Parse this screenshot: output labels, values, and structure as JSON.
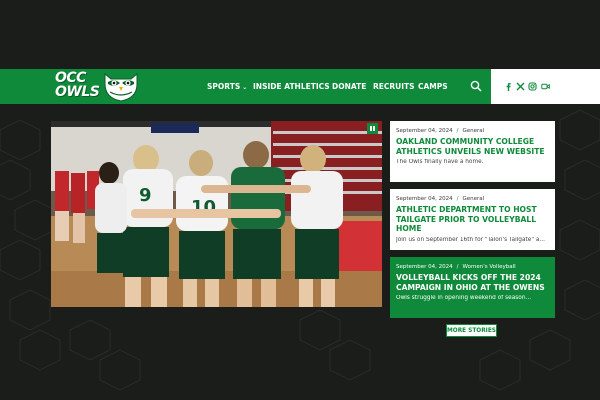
{
  "brand": {
    "line1": "OCC",
    "line2": "OWLS",
    "primary_color": "#0f8a3a",
    "background_color": "#1b1d1b",
    "mascot_icon": "owl-logo-icon"
  },
  "nav": {
    "items": [
      {
        "label": "SPORTS",
        "has_dropdown": true
      },
      {
        "label": "INSIDE ATHLETICS",
        "has_dropdown": true
      },
      {
        "label": "DONATE",
        "has_dropdown": false
      },
      {
        "label": "RECRUITS",
        "has_dropdown": false
      },
      {
        "label": "CAMPS",
        "has_dropdown": false
      }
    ],
    "dropdown_glyph": "⌄",
    "search_icon": "search-icon"
  },
  "social": {
    "icons": [
      "facebook-icon",
      "x-icon",
      "instagram-icon",
      "video-icon"
    ]
  },
  "hero": {
    "image_icon": "photo-volleyball-team-huddle",
    "pause_icon": "pause-icon"
  },
  "stories": [
    {
      "date": "September 04, 2024",
      "separator": "/",
      "category": "General",
      "headline": "OAKLAND COMMUNITY COLLEGE ATHLETICS UNVEILS NEW WEBSITE",
      "excerpt": "The Owls finally have a home."
    },
    {
      "date": "September 04, 2024",
      "separator": "/",
      "category": "General",
      "headline": "ATHLETIC DEPARTMENT TO HOST TAILGATE PRIOR TO VOLLEYBALL HOME",
      "excerpt": "Join us on September 16th for \"Talon's Tailgate\" a..."
    },
    {
      "date": "September 04, 2024",
      "separator": "/",
      "category": "Women's Volleyball",
      "headline": "VOLLEYBALL KICKS OFF THE 2024 CAMPAIGN IN OHIO AT THE OWENS",
      "excerpt": "Owls struggle in opening weekend of season..."
    }
  ],
  "more_stories_label": "MORE STORIES"
}
